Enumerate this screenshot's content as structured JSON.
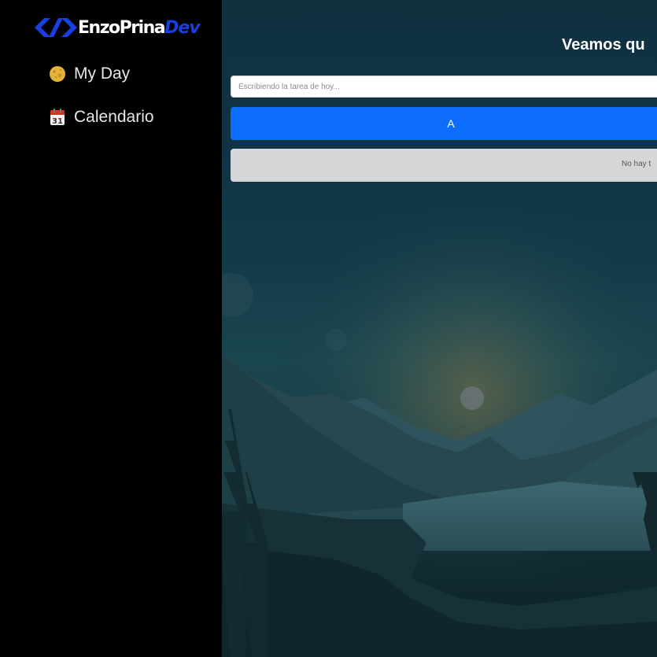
{
  "sidebar": {
    "logo": {
      "name": "EnzoPrina",
      "accent": "Dev",
      "mark_icon": "chevron-brackets-logo-icon"
    },
    "items": [
      {
        "label": "My Day",
        "icon": "moon-icon"
      },
      {
        "label": "Calendario",
        "icon": "calendar-icon",
        "icon_text": "31"
      }
    ]
  },
  "main": {
    "heading": "Veamos qu",
    "input": {
      "value": "",
      "placeholder": "Escribiendo la tarea de hoy..."
    },
    "add_button_label": "A",
    "empty_state": "No hay t",
    "background": "mountain-lake-landscape"
  },
  "colors": {
    "sidebar_bg": "#000000",
    "accent_blue": "#0d6efd",
    "logo_blue": "#1a3fe0",
    "empty_box": "#d6d6d8"
  }
}
